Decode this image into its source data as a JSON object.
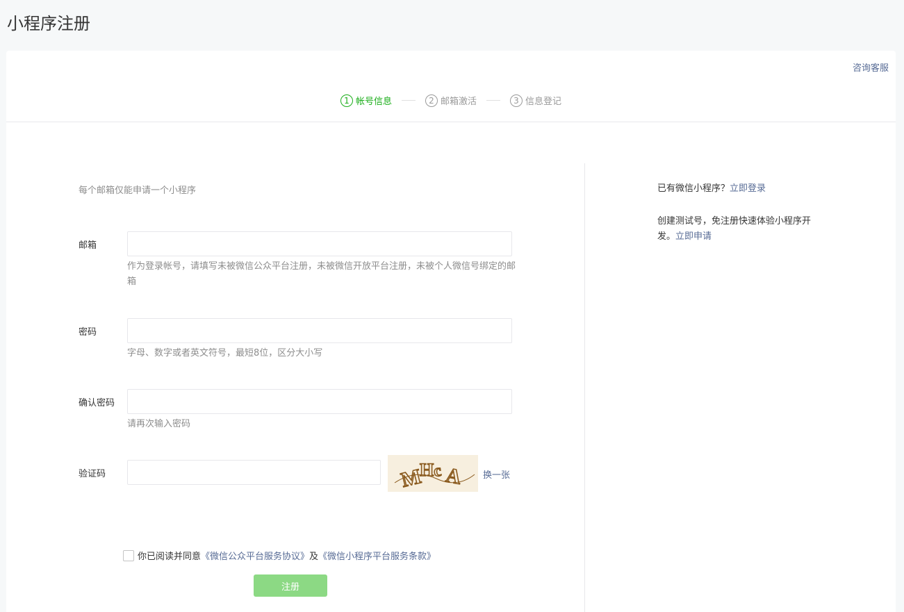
{
  "page": {
    "title": "小程序注册"
  },
  "header": {
    "consult_label": "咨询客服"
  },
  "steps": [
    {
      "num": "1",
      "label": "帐号信息"
    },
    {
      "num": "2",
      "label": "邮箱激活"
    },
    {
      "num": "3",
      "label": "信息登记"
    }
  ],
  "form": {
    "tip": "每个邮箱仅能申请一个小程序",
    "email": {
      "label": "邮箱",
      "value": "",
      "tip": "作为登录帐号，请填写未被微信公众平台注册，未被微信开放平台注册，未被个人微信号绑定的邮箱"
    },
    "password": {
      "label": "密码",
      "value": "",
      "tip": "字母、数字或者英文符号，最短8位，区分大小写"
    },
    "confirm": {
      "label": "确认密码",
      "value": "",
      "tip": "请再次输入密码"
    },
    "captcha": {
      "label": "验证码",
      "value": "",
      "image_text": "MHCA",
      "refresh_label": "换一张"
    },
    "agree": {
      "prefix": "你已阅读并同意",
      "link1": "《微信公众平台服务协议》",
      "middle": "及",
      "link2": "《微信小程序平台服务条款》"
    },
    "submit_label": "注册"
  },
  "side": {
    "have_account": "已有微信小程序？",
    "login_link": "立即登录",
    "test_text_1": "创建测试号，免注册快速体验小程序开",
    "test_text_2": "发。",
    "apply_link": "立即申请"
  },
  "colors": {
    "accent": "#1aad19",
    "link": "#576b95",
    "button_disabled": "#8cd984"
  }
}
